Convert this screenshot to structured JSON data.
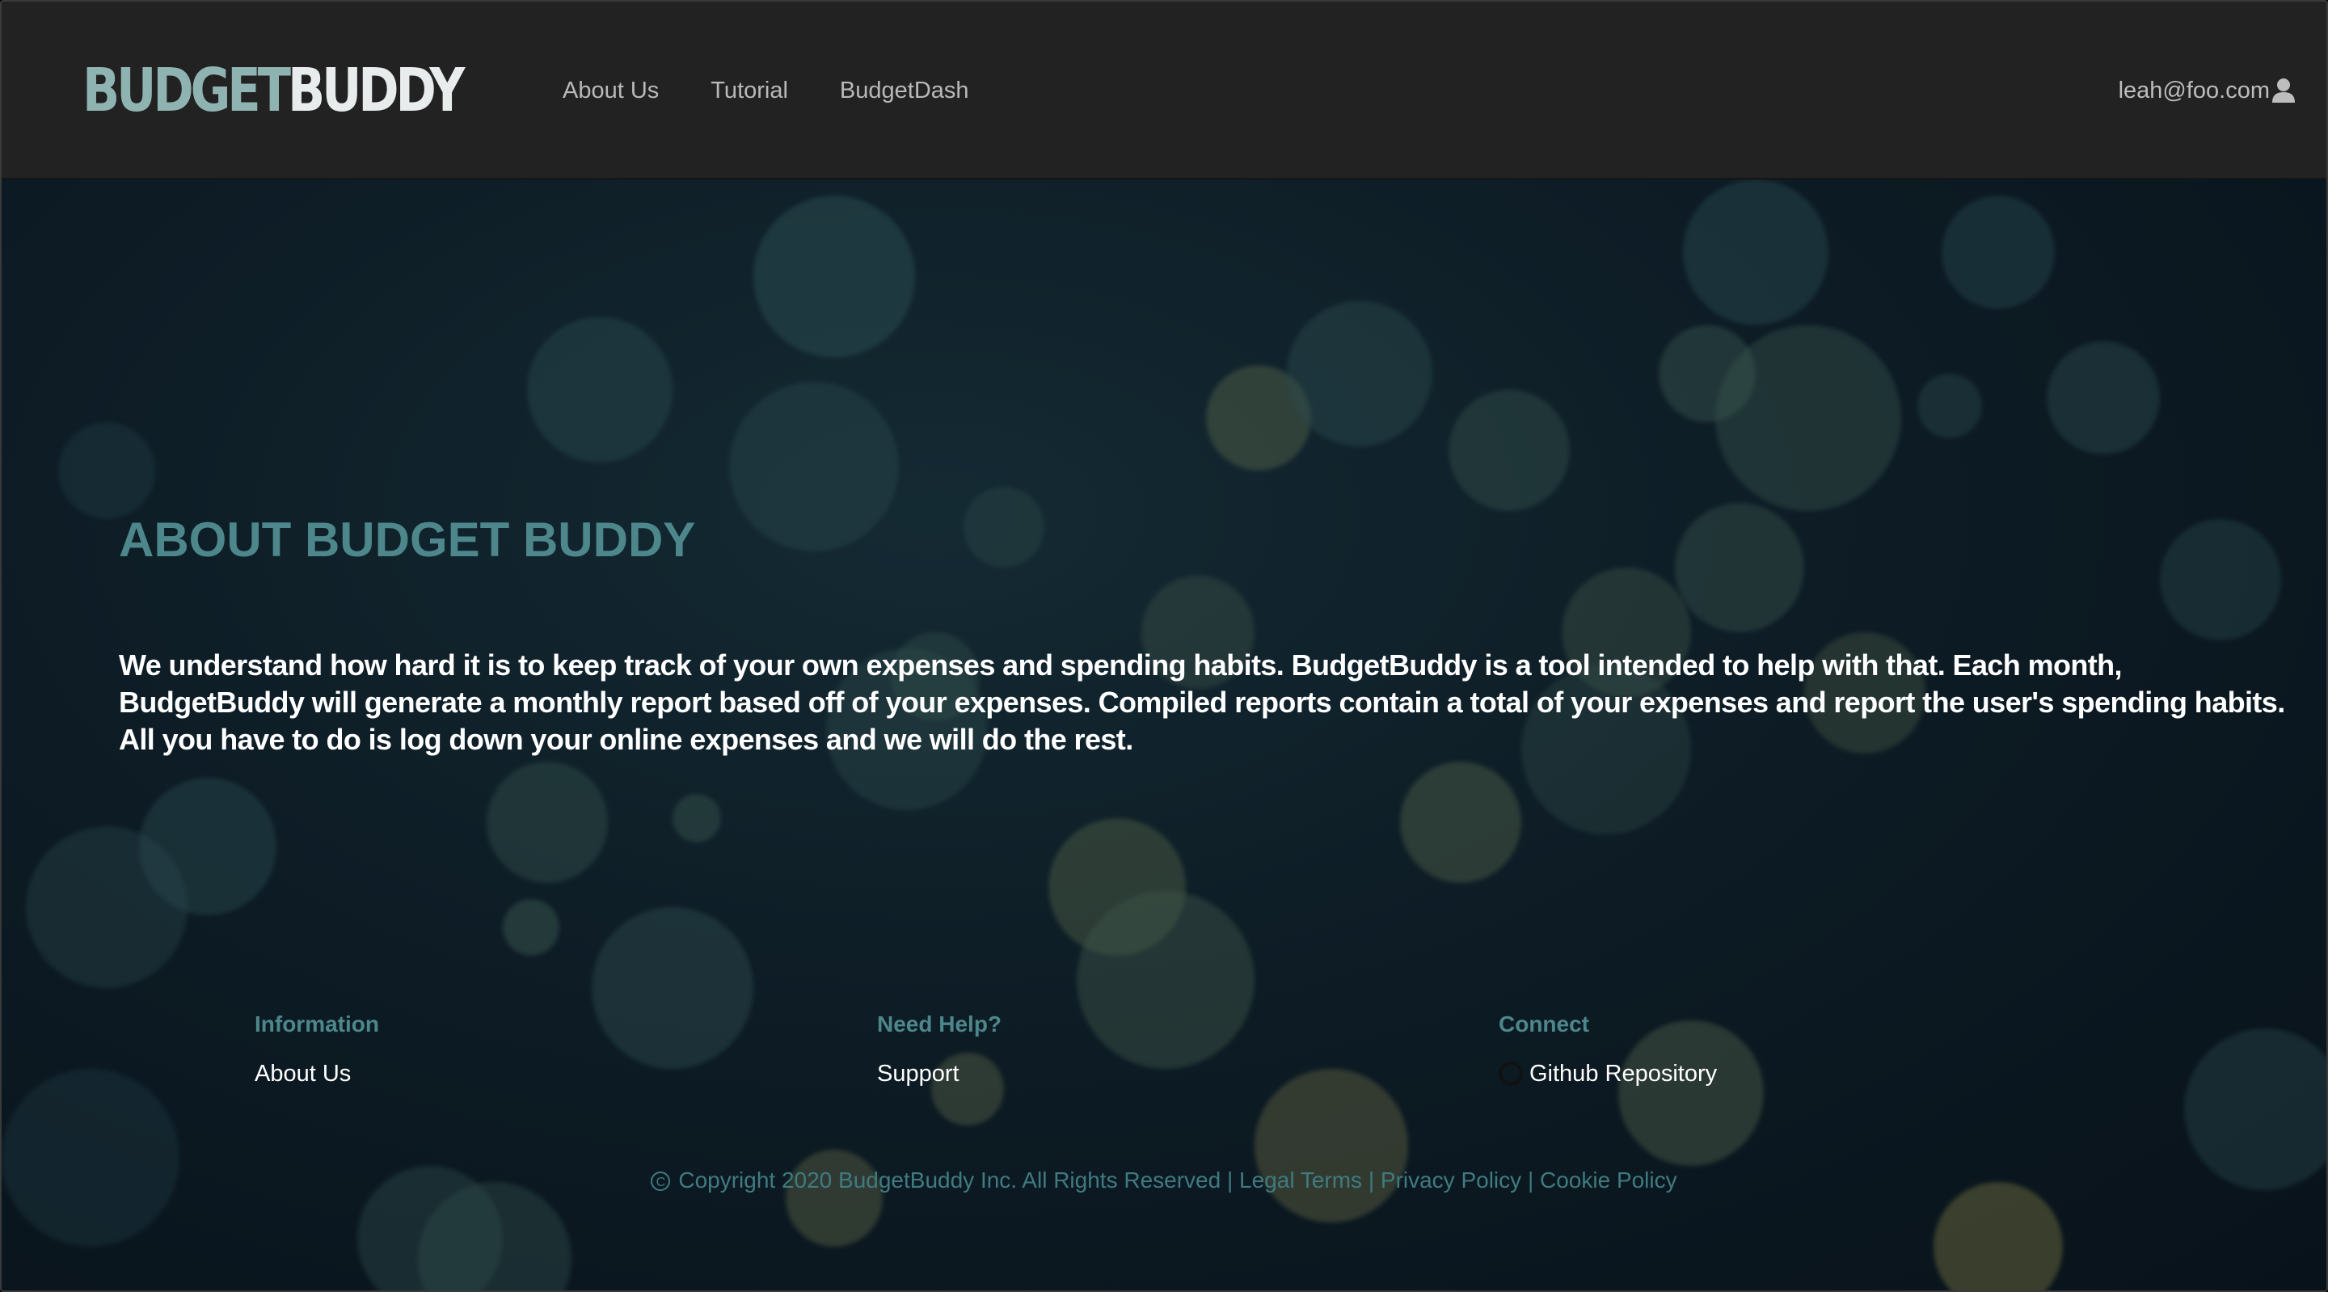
{
  "logo": {
    "part1": "BUDGET",
    "part2": "BUDDY"
  },
  "nav": {
    "items": [
      {
        "label": "About Us"
      },
      {
        "label": "Tutorial"
      },
      {
        "label": "BudgetDash"
      }
    ]
  },
  "user": {
    "email": "leah@foo.com",
    "icon": "user-icon"
  },
  "main": {
    "title": "ABOUT BUDGET BUDDY",
    "description": "We understand how hard it is to keep track of your own expenses and spending habits. BudgetBuddy is a tool intended to help with that. Each month, BudgetBuddy will generate a monthly report based off of your expenses. Compiled reports contain a total of your expenses and report the user's spending habits. All you have to do is log down your online expenses and we will do the rest."
  },
  "footer": {
    "columns": [
      {
        "heading": "Information",
        "link": "About Us"
      },
      {
        "heading": "Need Help?",
        "link": "Support"
      },
      {
        "heading": "Connect",
        "link": "Github Repository",
        "icon": "github-icon"
      }
    ],
    "copyright": "Copyright 2020 BudgetBuddy Inc. All Rights Reserved",
    "links": [
      "Legal Terms",
      "Privacy Policy",
      "Cookie Policy"
    ],
    "separator": "|"
  },
  "colors": {
    "header_bg": "#222222",
    "accent": "#4d878b",
    "logo_budget": "#8fb3b1",
    "logo_buddy": "#e9ecec",
    "hero_bg": "#0d1c25"
  }
}
